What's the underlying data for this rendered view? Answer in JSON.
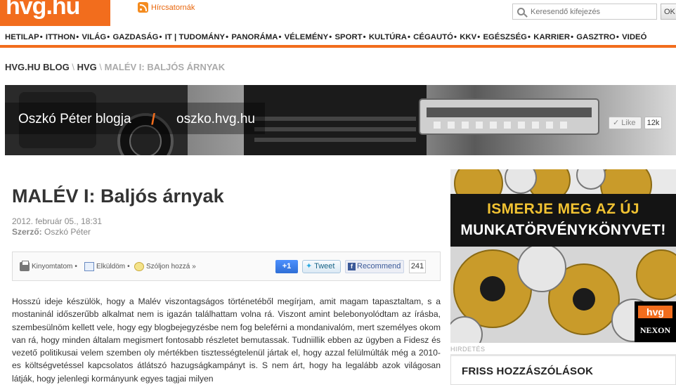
{
  "header": {
    "logo": "hvg.hu",
    "rss_label": "Hírcsatornák",
    "search_placeholder": "Keresendő kifejezés",
    "search_button": "OK"
  },
  "nav": {
    "items": [
      "HETILAP",
      "ITTHON",
      "VILÁG",
      "GAZDASÁG",
      "IT | TUDOMÁNY",
      "PANORÁMA",
      "VÉLEMÉNY",
      "SPORT",
      "KULTÚRA",
      "CÉGAUTÓ",
      "KKV",
      "EGÉSZSÉG",
      "KARRIER",
      "GASZTRO",
      "VIDEÓ"
    ]
  },
  "breadcrumb": {
    "item1": "HVG.HU BLOG",
    "item2": "HVG",
    "current": "MALÉV I: BALJÓS ÁRNYAK",
    "separator": "\\"
  },
  "banner": {
    "blog_name": "Oszkó Péter blogja",
    "slash": "/",
    "url": "oszko.hvg.hu",
    "like_label": "Like",
    "like_count": "12k"
  },
  "article": {
    "title": "MALÉV I: Baljós árnyak",
    "date": "2012. február 05., 18:31",
    "author_label": "Szerző:",
    "author": "Oszkó Péter",
    "body": "Hosszú ideje készülök, hogy a Malév viszontagságos történetéből megírjam, amit magam tapasztaltam, s a mostaninál időszerűbb alkalmat nem is igazán találhattam volna rá. Viszont amint belebonyolódtam az írásba, szembesülnöm kellett vele, hogy egy blogbejegyzésbe nem fog beleférni a mondanivalóm, mert személyes okom van rá, hogy minden általam megismert fontosabb részletet bemutassak. Tudniillik ebben az ügyben a Fidesz és vezető politikusai velem szemben oly mértékben tisztességtelenül jártak el, hogy azzal felülmúlták még a 2010-es költségvetéssel kapcsolatos átlátszó hazugságkampányt is. S nem árt, hogy ha legalább azok világosan látják, hogy jelenlegi kormányunk egyes tagjai milyen"
  },
  "share": {
    "print": "Kinyomtatom",
    "send": "Elküldöm",
    "comment": "Szóljon hozzá",
    "comment_arrow": "»",
    "gplus": "+1",
    "tweet": "Tweet",
    "recommend": "Recommend",
    "recommend_count": "241",
    "bullet": "•"
  },
  "sidebar": {
    "ad_line1": "ISMERJE MEG AZ ÚJ",
    "ad_line2": "MUNKATÖRVÉNYKÖNYVET!",
    "ad_brand_hvg": "hvg",
    "ad_brand_nexon": "NEXON",
    "ad_label": "HIRDETÉS",
    "friss_title": "FRISS HOZZÁSZÓLÁSOK"
  },
  "colors": {
    "brand_orange": "#f26d1d",
    "ad_yellow": "#f1c232"
  }
}
